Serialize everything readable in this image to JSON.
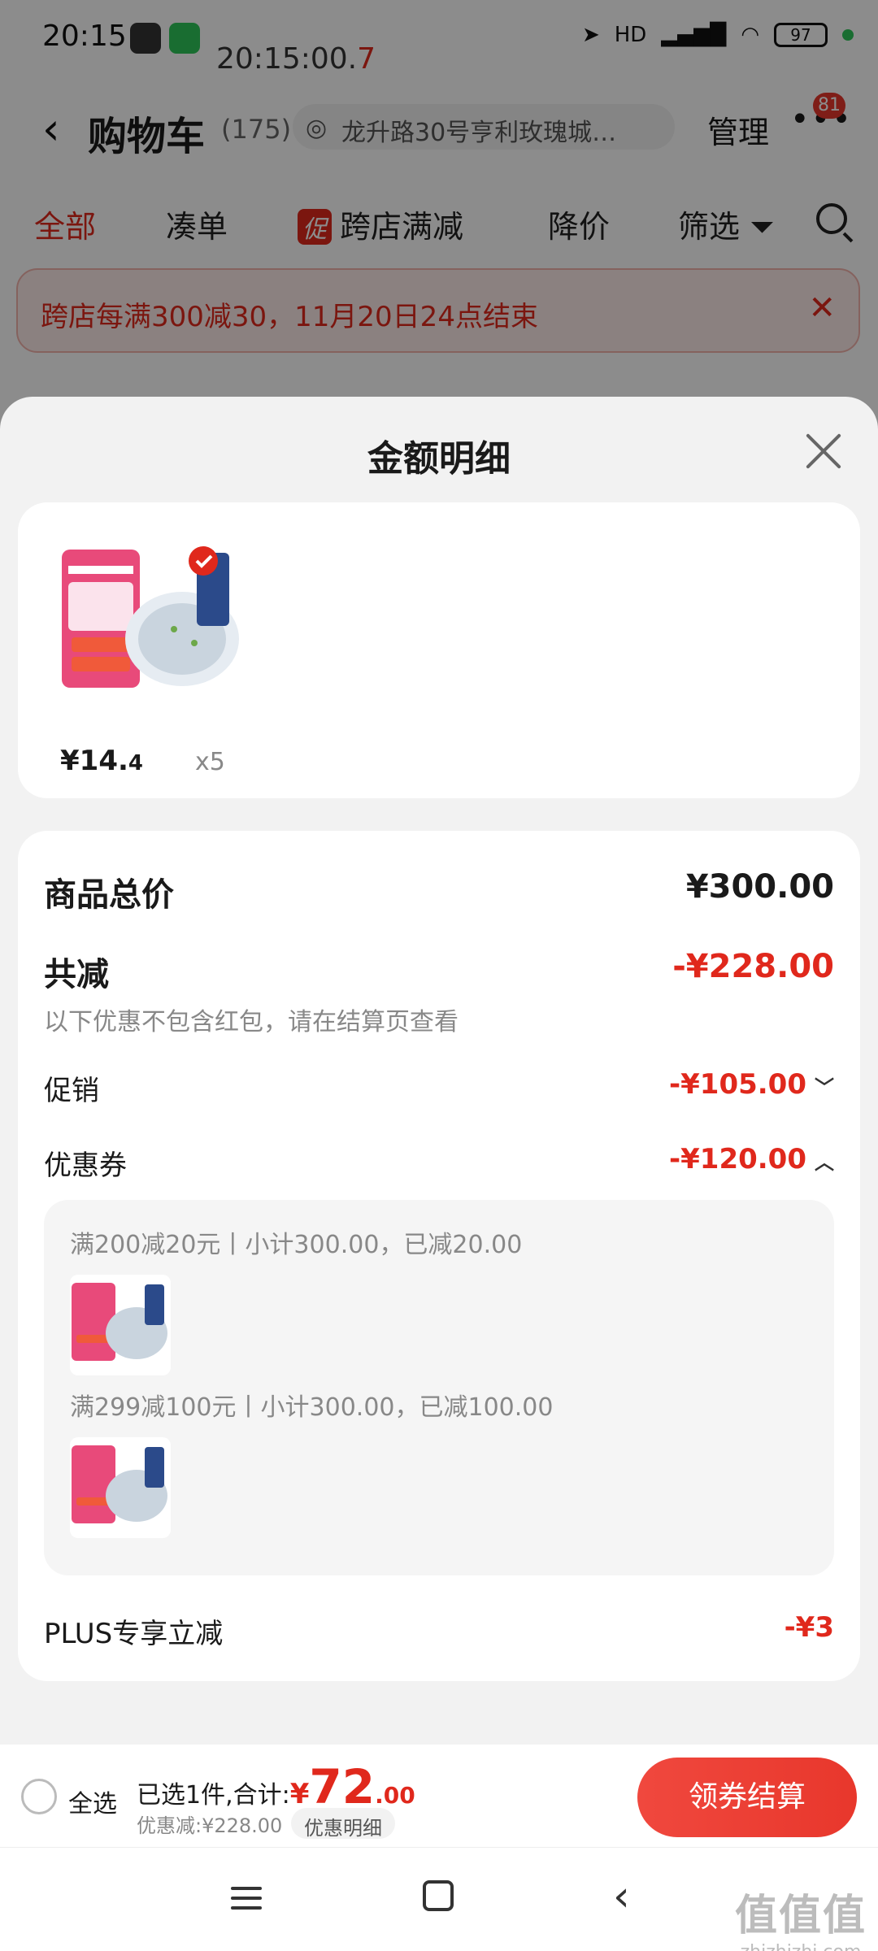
{
  "status_bar": {
    "time": "20:15",
    "timer": "20:15:00.",
    "timer_red": "7",
    "network": "HD",
    "battery": "97"
  },
  "header": {
    "title": "购物车",
    "count": "(175)",
    "address": "龙升路30号亨利玫瑰城…",
    "manage": "管理",
    "badge": "81"
  },
  "tabs": [
    "全部",
    "凑单",
    "跨店满减",
    "降价",
    "筛选"
  ],
  "promo_tag": "促",
  "banner": {
    "text": "跨店每满300减30，11月20日24点结束"
  },
  "sheet": {
    "title": "金额明细",
    "product": {
      "price_main": "¥14.",
      "price_cents": "4",
      "qty": "x5"
    },
    "rows": {
      "total_label": "商品总价",
      "total_value": "¥300.00",
      "reduce_label": "共减",
      "reduce_value": "-¥228.00",
      "note": "以下优惠不包含红包，请在结算页查看",
      "promo_label": "促销",
      "promo_value": "-¥105.00",
      "coupon_label": "优惠券",
      "coupon_value": "-¥120.00",
      "plus_label": "PLUS专享立减",
      "plus_value": "-¥3"
    },
    "coupons": [
      {
        "text": "满200减20元丨小计300.00，已减20.00"
      },
      {
        "text": "满299减100元丨小计300.00，已减100.00"
      }
    ]
  },
  "bottom_bar": {
    "select_all": "全选",
    "sum_prefix": "已选1件,合计:",
    "sum_currency": "¥",
    "sum_int": "72",
    "sum_cents": ".00",
    "discount": "优惠减:¥228.00",
    "detail_chip": "优惠明细",
    "checkout": "领券结算"
  },
  "watermark": {
    "big": "值值值",
    "small": "zhizhizhi.com"
  },
  "colors": {
    "accent": "#e0281c",
    "sheet_bg": "#f2f2f2"
  }
}
